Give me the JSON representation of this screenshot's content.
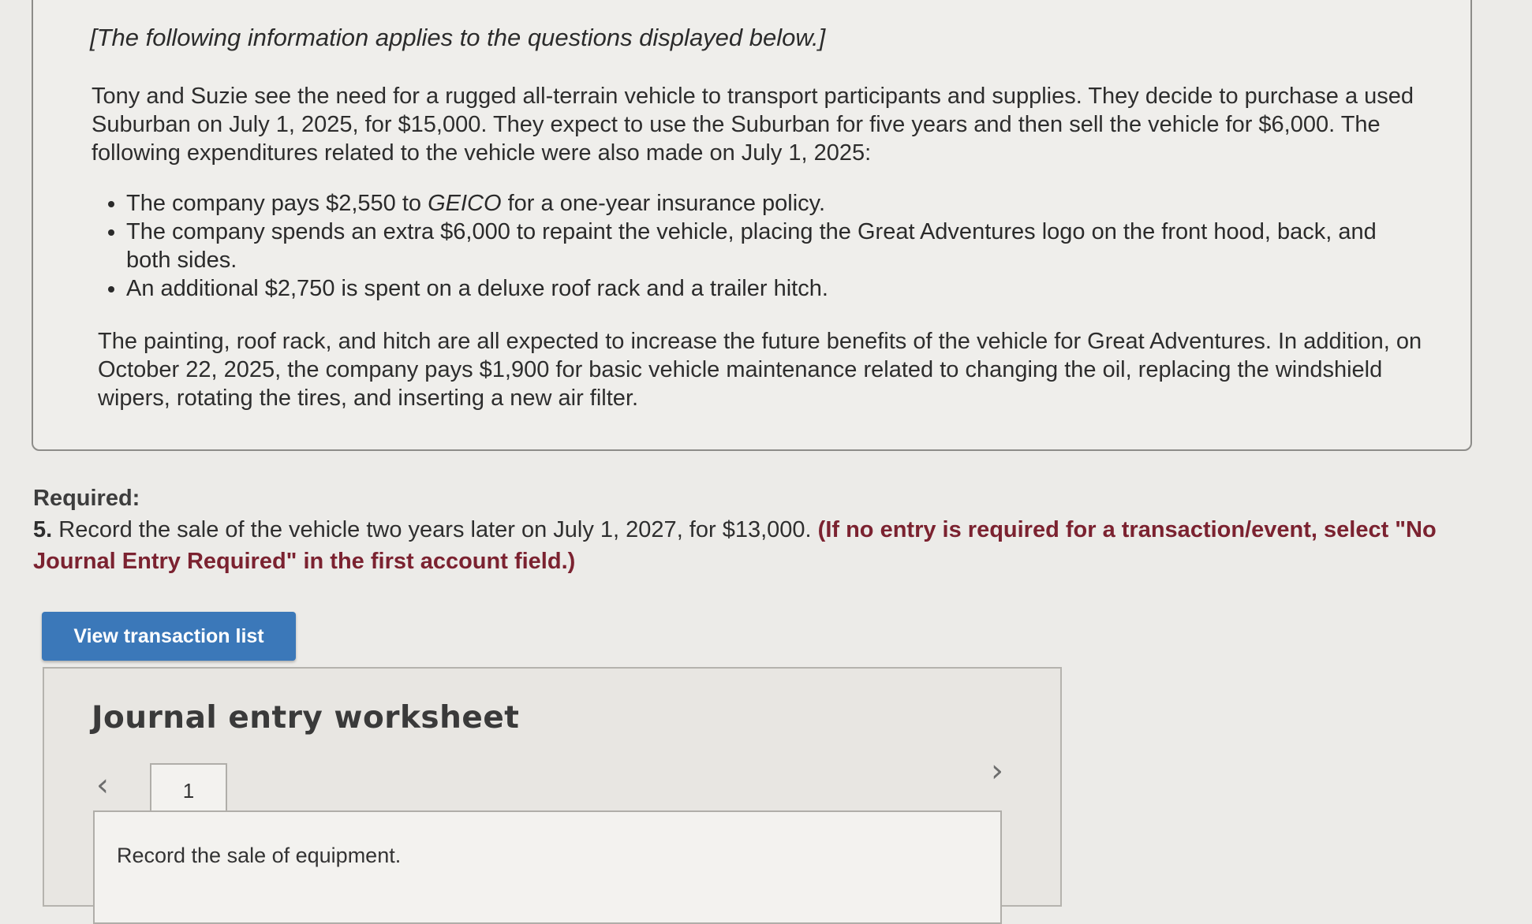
{
  "info": {
    "intro": "[The following information applies to the questions displayed below.]",
    "paragraph1": "Tony and Suzie see the need for a rugged all-terrain vehicle to transport participants and supplies. They decide to purchase a used Suburban on July 1, 2025, for $15,000. They expect to use the Suburban for five years and then sell the vehicle for $6,000. The following expenditures related to the vehicle were also made on July 1, 2025:",
    "bullet1_before": "The company pays $2,550 to ",
    "bullet1_insurer": "GEICO",
    "bullet1_after": " for a one-year insurance policy.",
    "bullet2": "The company spends an extra $6,000 to repaint the vehicle, placing the Great Adventures logo on the front hood, back, and both sides.",
    "bullet3": "An additional $2,750 is spent on a deluxe roof rack and a trailer hitch.",
    "paragraph2": "The painting, roof rack, and hitch are all expected to increase the future benefits of the vehicle for Great Adventures. In addition, on October 22, 2025, the company pays $1,900 for basic vehicle maintenance related to changing the oil, replacing the windshield wipers, rotating the tires, and inserting a new air filter."
  },
  "required": {
    "title": "Required:",
    "number": "5.",
    "text": "Record the sale of the vehicle two years later on July 1, 2027, for $13,000.",
    "note": "(If no entry is required for a transaction/event, select \"No Journal Entry Required\" in the first account field.)"
  },
  "buttons": {
    "view_transactions": "View transaction list"
  },
  "worksheet": {
    "title": "Journal entry worksheet",
    "prev_icon": "chevron-left-icon",
    "next_icon": "chevron-right-icon",
    "active_tab": "1",
    "instruction": "Record the sale of equipment."
  },
  "colors": {
    "button_bg": "#3b78b9",
    "note_color": "#7b2230",
    "page_bg": "#ecebe8"
  }
}
